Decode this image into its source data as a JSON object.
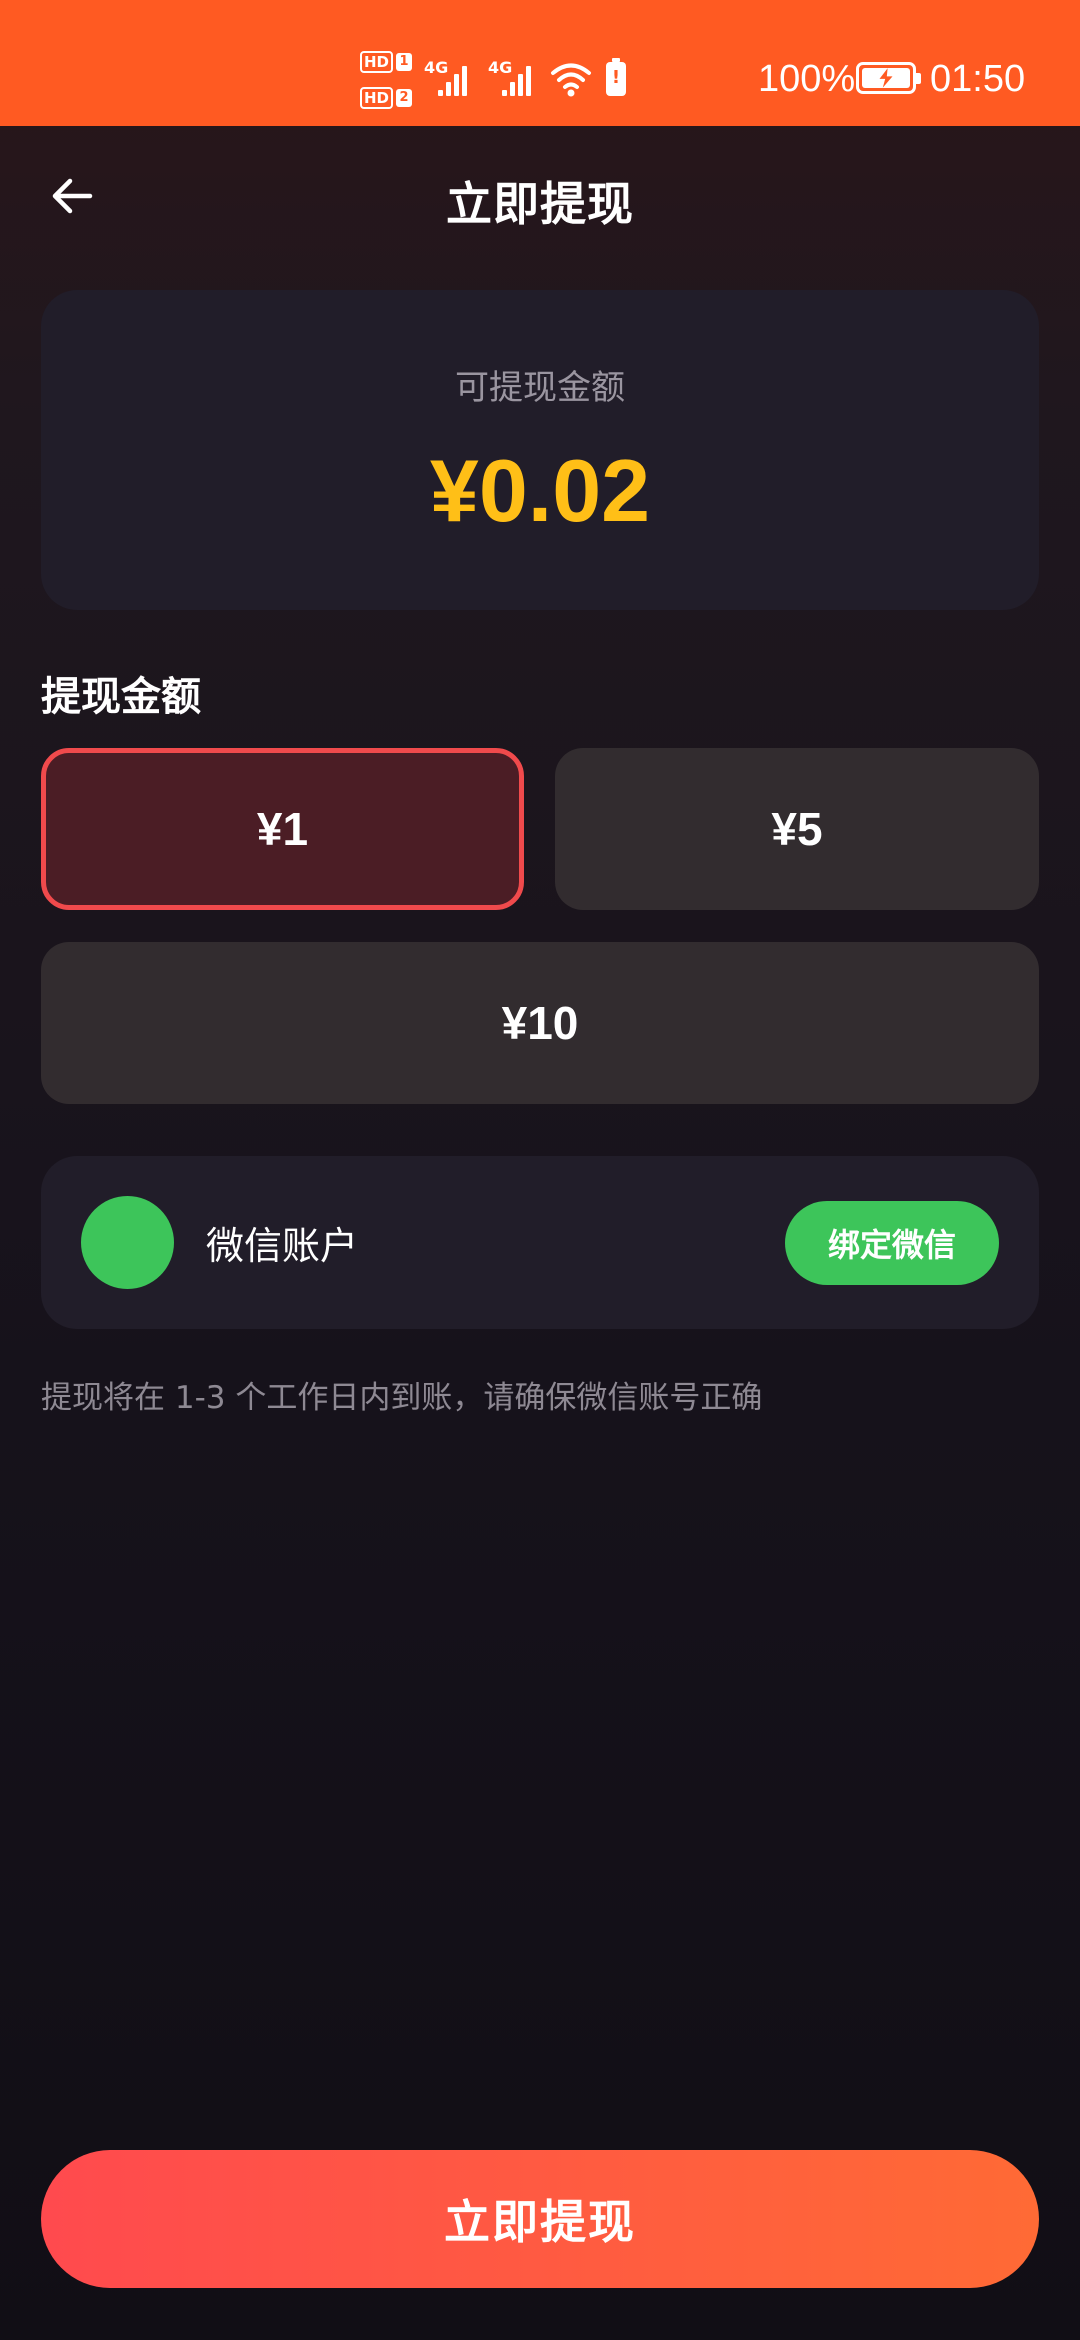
{
  "status_bar": {
    "sim1_label": "HD",
    "sim1_num": "1",
    "sim2_label": "HD",
    "sim2_num": "2",
    "network1": "4G",
    "network2": "4G",
    "battery_saver_icon": "!",
    "battery_percent": "100%",
    "time": "01:50"
  },
  "header": {
    "title": "立即提现",
    "back_icon": "arrow-left-icon"
  },
  "balance": {
    "label": "可提现金额",
    "amount": "¥0.02",
    "amount_color": "#ffbf17"
  },
  "withdraw": {
    "section_title": "提现金额",
    "options": [
      {
        "label": "¥1",
        "selected": true
      },
      {
        "label": "¥5",
        "selected": false
      },
      {
        "label": "¥10",
        "selected": false
      }
    ]
  },
  "wechat": {
    "account_label": "微信账户",
    "bind_button": "绑定微信",
    "brand_color": "#3dc55a"
  },
  "notice": "提现将在 1-3 个工作日内到账，请确保微信账号正确",
  "submit_button": "立即提现",
  "colors": {
    "status_bar": "#ff5a22",
    "selected_border": "#f04a4c",
    "submit_gradient_start": "#ff4a4e",
    "submit_gradient_end": "#ff6a35"
  }
}
